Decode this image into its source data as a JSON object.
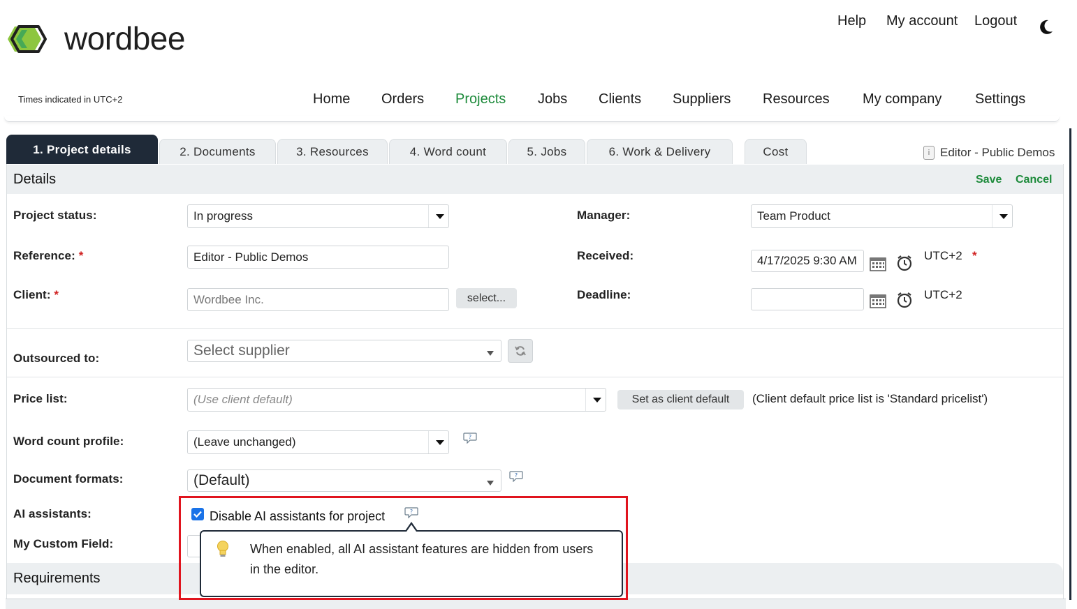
{
  "brand": {
    "name": "wordbee"
  },
  "top_links": {
    "help": "Help",
    "account": "My account",
    "logout": "Logout"
  },
  "timezone_note": "Times indicated in UTC+2",
  "main_nav": [
    {
      "label": "Home"
    },
    {
      "label": "Orders"
    },
    {
      "label": "Projects",
      "active": true
    },
    {
      "label": "Jobs"
    },
    {
      "label": "Clients"
    },
    {
      "label": "Suppliers"
    },
    {
      "label": "Resources"
    },
    {
      "label": "My company"
    },
    {
      "label": "Settings"
    }
  ],
  "tabs": [
    {
      "label": "1. Project details",
      "active": true
    },
    {
      "label": "2. Documents"
    },
    {
      "label": "3. Resources"
    },
    {
      "label": "4. Word count"
    },
    {
      "label": "5. Jobs"
    },
    {
      "label": "6. Work & Delivery"
    },
    {
      "label": "Cost"
    }
  ],
  "project_name": "Editor - Public Demos",
  "details": {
    "title": "Details",
    "save": "Save",
    "cancel": "Cancel",
    "project_status": {
      "label": "Project status:",
      "value": "In progress"
    },
    "reference": {
      "label": "Reference:",
      "value": "Editor - Public Demos"
    },
    "client": {
      "label": "Client:",
      "value": "Wordbee Inc.",
      "select_btn": "select..."
    },
    "manager": {
      "label": "Manager:",
      "value": "Team Product"
    },
    "received": {
      "label": "Received:",
      "value": "4/17/2025 9:30 AM",
      "tz": "UTC+2"
    },
    "deadline": {
      "label": "Deadline:",
      "value": "",
      "tz": "UTC+2"
    },
    "required_mark": "*",
    "outsourced": {
      "label": "Outsourced to:",
      "placeholder": "Select supplier"
    },
    "price_list": {
      "label": "Price list:",
      "value": "(Use client default)",
      "set_default_btn": "Set as client default",
      "note": "(Client default price list is 'Standard pricelist')"
    },
    "word_count_profile": {
      "label": "Word count profile:",
      "value": "(Leave unchanged)"
    },
    "document_formats": {
      "label": "Document formats:",
      "value": "(Default)"
    },
    "ai_assistants": {
      "label": "AI assistants:",
      "checkbox_label": "Disable AI assistants for project",
      "checked": true
    },
    "custom_field": {
      "label": "My Custom Field:"
    }
  },
  "tooltip": {
    "text": "When enabled, all AI assistant features are hidden from users in the editor."
  },
  "requirements": {
    "title": "Requirements"
  },
  "colors": {
    "accent_green": "#1c8a3a",
    "dark_navy": "#1f2a38",
    "highlight_red": "#e0141e"
  }
}
